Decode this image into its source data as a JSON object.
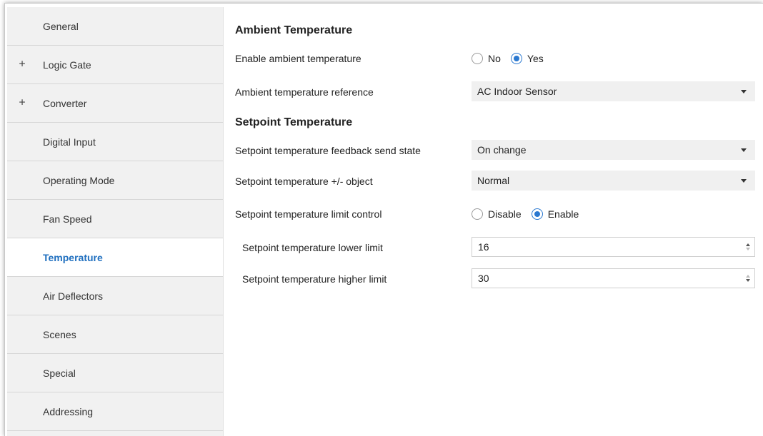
{
  "sidebar": {
    "items": [
      {
        "label": "General",
        "expandable": false,
        "active": false
      },
      {
        "label": "Logic Gate",
        "expandable": true,
        "active": false
      },
      {
        "label": "Converter",
        "expandable": true,
        "active": false
      },
      {
        "label": "Digital Input",
        "expandable": false,
        "active": false
      },
      {
        "label": "Operating Mode",
        "expandable": false,
        "active": false
      },
      {
        "label": "Fan Speed",
        "expandable": false,
        "active": false
      },
      {
        "label": "Temperature",
        "expandable": false,
        "active": true
      },
      {
        "label": "Air Deflectors",
        "expandable": false,
        "active": false
      },
      {
        "label": "Scenes",
        "expandable": false,
        "active": false
      },
      {
        "label": "Special",
        "expandable": false,
        "active": false
      },
      {
        "label": "Addressing",
        "expandable": false,
        "active": false
      }
    ],
    "expand_symbol": "+"
  },
  "ambient": {
    "heading": "Ambient Temperature",
    "enable_label": "Enable ambient temperature",
    "enable_options": [
      "No",
      "Yes"
    ],
    "enable_selected": "Yes",
    "reference_label": "Ambient temperature reference",
    "reference_value": "AC Indoor Sensor"
  },
  "setpoint": {
    "heading": "Setpoint Temperature",
    "feedback_label": "Setpoint temperature feedback send state",
    "feedback_value": "On change",
    "object_label": "Setpoint temperature +/- object",
    "object_value": "Normal",
    "limit_label": "Setpoint temperature limit control",
    "limit_options": [
      "Disable",
      "Enable"
    ],
    "limit_selected": "Enable",
    "lower_label": "Setpoint temperature lower limit",
    "lower_value": "16",
    "higher_label": "Setpoint temperature higher limit",
    "higher_value": "30"
  },
  "colors": {
    "accent": "#2a78d0",
    "active_text": "#1f6fbf",
    "sidebar_bg": "#f1f1f1",
    "select_bg": "#f0f0f0"
  },
  "icons": {
    "expand": "plus-icon",
    "dropdown": "chevron-down-icon",
    "spin_up": "arrow-up-icon",
    "spin_down": "arrow-down-icon"
  }
}
